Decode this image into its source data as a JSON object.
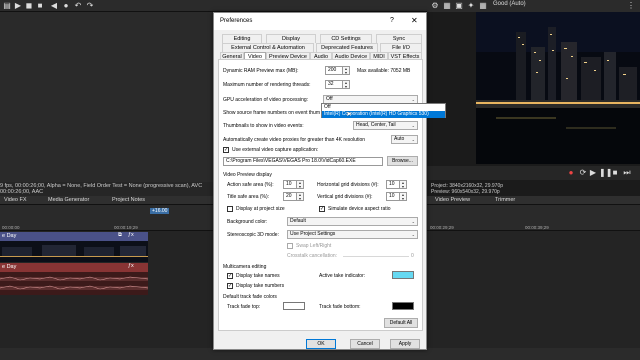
{
  "topbar": {
    "icons": [
      "folder-open-icon",
      "play-icon",
      "pause-icon",
      "stop-icon",
      "record-icon"
    ]
  },
  "preview": {
    "quality": "Good (Auto)",
    "info_project": "Project:  3840x2160x32, 29.970p",
    "info_preview": "Preview:  960x540x32, 29.970p",
    "tabs": [
      "Video Preview",
      "Trimmer"
    ]
  },
  "status": {
    "line1": "9 fps, 00:00:26;00, Alpha = None, Field Order Test = None (progressive scan), AVC",
    "line2": "00:00:26;00, AAC"
  },
  "left_tabs": [
    "Video FX",
    "Media Generator",
    "Project Notes"
  ],
  "timeline": {
    "rate": "+16.00",
    "ruler_labels": [
      "00:00:00",
      "00:00:19;29",
      "00:00:29;29",
      "00:00:39;29"
    ],
    "track1_name": "e Day",
    "track2_name": "e Day"
  },
  "dialog": {
    "title": "Preferences",
    "help": "?",
    "close": "✕",
    "tabs_row1": [
      "Editing",
      "Display",
      "CD Settings",
      "Sync"
    ],
    "tabs_row2": [
      "External Control & Automation",
      "Deprecated Features",
      "File I/O"
    ],
    "tabs_row3": [
      "General",
      "Video",
      "Preview Device",
      "Audio",
      "Audio Device",
      "MIDI",
      "VST Effects"
    ],
    "dynamic_ram_label": "Dynamic RAM Preview max (MB):",
    "dynamic_ram_value": "200",
    "max_available": "Max available: 7052 MB",
    "render_threads_label": "Maximum number of rendering threads:",
    "render_threads_value": "32",
    "gpu_label": "GPU acceleration of video processing:",
    "gpu_value": "Off",
    "gpu_options": [
      "Off",
      "Intel(R) Corporation (Intel(R) HD Graphics 530)"
    ],
    "source_frame_label": "Show source frame numbers on event thum",
    "source_frame_value": "",
    "thumbs_label": "Thumbnails to show in video events:",
    "thumbs_value": "Head, Center, Tail",
    "proxies_label": "Automatically create video proxies for greater than 4K resolution",
    "proxies_value": "Auto",
    "ext_capture_label": "Use external video capture application:",
    "ext_capture_path": "C:\\Program Files\\VEGAS\\VEGAS Pro 18.0\\VidCap60.EXE",
    "browse": "Browse...",
    "video_preview_section": "Video Preview display",
    "action_safe_label": "Action safe area (%):",
    "action_safe_value": "10",
    "title_safe_label": "Title safe area (%):",
    "title_safe_value": "20",
    "hgrid_label": "Horizontal grid divisions (#):",
    "hgrid_value": "10",
    "vgrid_label": "Vertical grid divisions (#):",
    "vgrid_value": "10",
    "display_project_size": "Display at project size",
    "simulate_aspect": "Simulate device aspect ratio",
    "bg_color_label": "Background color:",
    "bg_color_value": "Default",
    "stereo_label": "Stereoscopic 3D mode:",
    "stereo_value": "Use Project Settings",
    "swap_lr": "Swap Left/Right",
    "crosstalk_label": "Crosstalk cancellation:",
    "crosstalk_value": "0",
    "multicam_section": "Multicamera editing",
    "display_take_names": "Display take names",
    "display_take_numbers": "Display take numbers",
    "active_take_label": "Active take indicator:",
    "active_take_color": "#66d9f2",
    "fade_section": "Default track fade colors",
    "fade_top_label": "Track fade top:",
    "fade_top_color": "#ffffff",
    "fade_bottom_label": "Track fade bottom:",
    "fade_bottom_color": "#000000",
    "default_all": "Default All",
    "ok": "OK",
    "cancel": "Cancel",
    "apply": "Apply",
    "check": "✓"
  }
}
